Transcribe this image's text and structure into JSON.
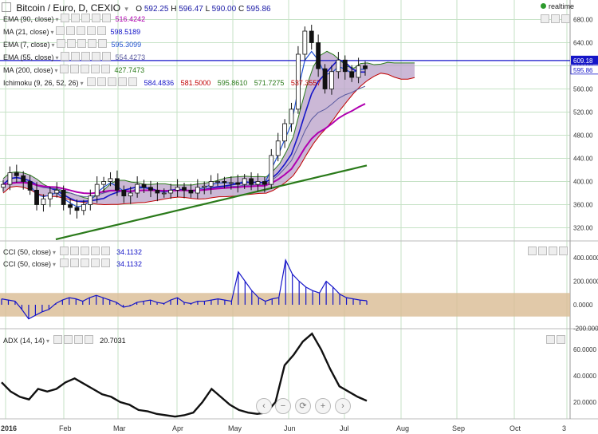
{
  "header": {
    "title": "Bitcoin / Euro, D, CEXIO",
    "ohlc": [
      {
        "k": "O",
        "v": "592.25"
      },
      {
        "k": "H",
        "v": "596.47"
      },
      {
        "k": "L",
        "v": "590.00"
      },
      {
        "k": "C",
        "v": "595.86"
      }
    ],
    "realtime_label": "realtime"
  },
  "main_indicators": [
    {
      "label": "EMA (90, close)",
      "value": "516.4242",
      "color": "#b000b0"
    },
    {
      "label": "MA (21, close)",
      "value": "598.5189",
      "color": "#1515c8"
    },
    {
      "label": "EMA (7, close)",
      "value": "595.3099",
      "color": "#2050d0"
    },
    {
      "label": "EMA (55, close)",
      "value": "554.4273",
      "color": "#5a5aa0"
    },
    {
      "label": "MA (200, close)",
      "value": "427.7473",
      "color": "#2a7a1a"
    }
  ],
  "ichimoku": {
    "label": "Ichimoku (9, 26, 52, 26)",
    "values": [
      {
        "v": "584.4836",
        "color": "#1515c8"
      },
      {
        "v": "581.5000",
        "color": "#c00000"
      },
      {
        "v": "595.8610",
        "color": "#2a7a1a"
      },
      {
        "v": "571.7275",
        "color": "#2a7a1a"
      },
      {
        "v": "537.3557",
        "color": "#c00000"
      }
    ]
  },
  "cci_indicators": [
    {
      "label": "CCI (50, close)",
      "value": "34.1132"
    },
    {
      "label": "CCI (50, close)",
      "value": "34.1132"
    }
  ],
  "adx_indicator": {
    "label": "ADX (14, 14)",
    "value": "20.7031"
  },
  "price_axis": {
    "ticks": [
      "680.00",
      "640.00",
      "600.00",
      "560.00",
      "520.00",
      "480.00",
      "440.00",
      "400.00",
      "360.00",
      "320.00"
    ],
    "current_label": "609.18",
    "last_label": "595.86"
  },
  "cci_axis": {
    "ticks": [
      "400.0000",
      "200.0000",
      "0.0000",
      "-200.0000"
    ]
  },
  "adx_axis": {
    "ticks": [
      "60.0000",
      "40.0000",
      "20.0000"
    ]
  },
  "time_axis": {
    "ticks": [
      "2016",
      "Feb",
      "Mar",
      "Apr",
      "May",
      "Jun",
      "Jul",
      "Aug",
      "Sep",
      "Oct",
      "3"
    ]
  },
  "nav_buttons": [
    "‹",
    "−",
    "⟳",
    "+",
    "›"
  ],
  "colors": {
    "up_fill": "#ffffff",
    "candle": "#111111",
    "cloud": "#b9a0c8",
    "cci_band": "#d9bc93",
    "grid": "#c6e2c6"
  },
  "chart_data": [
    {
      "type": "candlestick",
      "title": "Bitcoin / Euro, D, CEXIO",
      "x": [
        "2016-01-01",
        "2016-10-03"
      ],
      "ylim": [
        300,
        700
      ],
      "horizontal_line": 609.18,
      "series": [
        {
          "name": "Price",
          "values_close": [
            395,
            415,
            410,
            400,
            385,
            360,
            370,
            380,
            385,
            360,
            355,
            350,
            360,
            375,
            395,
            400,
            405,
            385,
            375,
            380,
            395,
            390,
            385,
            380,
            380,
            385,
            390,
            385,
            380,
            390,
            392,
            400,
            400,
            398,
            398,
            395,
            405,
            395,
            400,
            395,
            445,
            470,
            500,
            525,
            620,
            660,
            640,
            595,
            560,
            590,
            610,
            590,
            580,
            600,
            595
          ]
        },
        {
          "name": "EMA (90, close)",
          "last": 516.4242
        },
        {
          "name": "MA (21, close)",
          "last": 598.5189
        },
        {
          "name": "EMA (7, close)",
          "last": 595.3099
        },
        {
          "name": "EMA (55, close)",
          "last": 554.4273
        },
        {
          "name": "MA (200, close)",
          "last": 427.7473
        },
        {
          "name": "Ichimoku (9, 26, 52, 26)",
          "values": [
            584.4836,
            581.5,
            595.861,
            571.7275,
            537.3557
          ]
        }
      ]
    },
    {
      "type": "bar",
      "title": "CCI (50, close)",
      "ylim": [
        -200,
        400
      ],
      "band": [
        -100,
        100
      ],
      "values": [
        50,
        40,
        30,
        -40,
        -120,
        -90,
        -60,
        -40,
        10,
        40,
        60,
        50,
        30,
        60,
        80,
        60,
        40,
        20,
        -20,
        -10,
        20,
        30,
        40,
        20,
        10,
        40,
        60,
        20,
        10,
        30,
        30,
        40,
        50,
        40,
        30,
        280,
        200,
        120,
        60,
        30,
        50,
        60,
        380,
        260,
        200,
        150,
        120,
        100,
        200,
        150,
        90,
        60,
        50,
        40,
        34
      ]
    },
    {
      "type": "line",
      "title": "ADX (14, 14)",
      "ylim": [
        0,
        72
      ],
      "values": [
        35,
        28,
        24,
        22,
        30,
        28,
        30,
        35,
        38,
        34,
        30,
        26,
        24,
        20,
        18,
        14,
        13,
        11,
        10,
        9,
        10,
        12,
        20,
        30,
        24,
        18,
        14,
        12,
        11,
        12,
        20,
        48,
        56,
        66,
        72,
        60,
        45,
        32,
        28,
        24,
        21
      ]
    }
  ]
}
